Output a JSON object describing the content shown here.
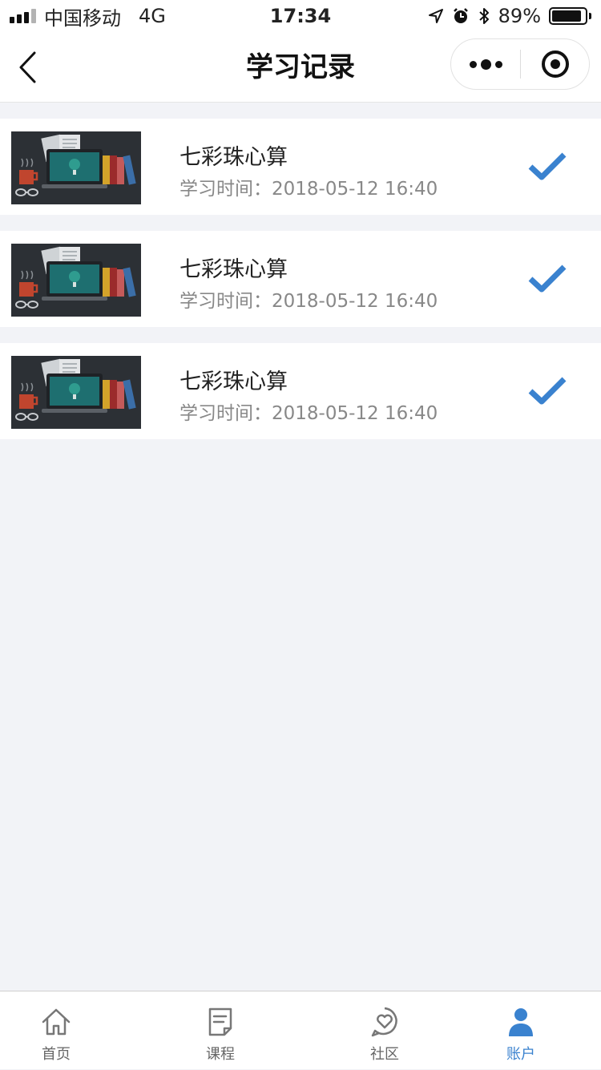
{
  "status_bar": {
    "carrier": "中国移动",
    "network": "4G",
    "time": "17:34",
    "battery_percent": "89%",
    "battery_level": 0.89
  },
  "nav": {
    "title": "学习记录"
  },
  "records": [
    {
      "title": "七彩珠心算",
      "time_label": "学习时间：",
      "time_value": "2018-05-12 16:40",
      "completed": true
    },
    {
      "title": "七彩珠心算",
      "time_label": "学习时间：",
      "time_value": "2018-05-12 16:40",
      "completed": true
    },
    {
      "title": "七彩珠心算",
      "time_label": "学习时间：",
      "time_value": "2018-05-12 16:40",
      "completed": true
    }
  ],
  "tabs": [
    {
      "label": "首页",
      "icon": "home-icon",
      "active": false
    },
    {
      "label": "课程",
      "icon": "course-icon",
      "active": false
    },
    {
      "label": "社区",
      "icon": "community-icon",
      "active": false
    },
    {
      "label": "账户",
      "icon": "account-icon",
      "active": true
    }
  ],
  "colors": {
    "accent": "#3a82cf",
    "background": "#f2f3f7",
    "check": "#3a82cf"
  }
}
